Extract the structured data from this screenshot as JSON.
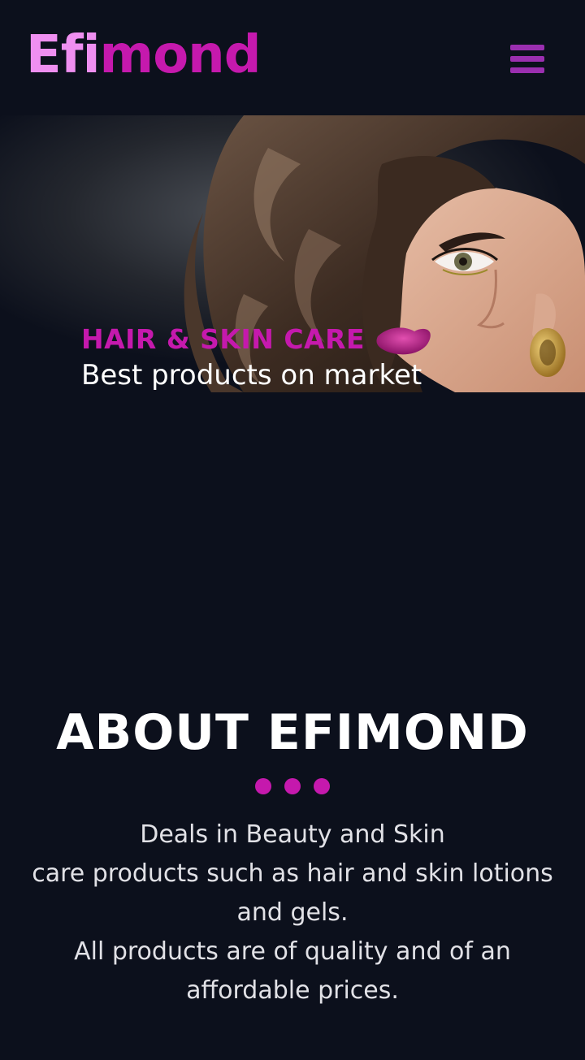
{
  "header": {
    "logo_part1": "Efi",
    "logo_part2": "mond",
    "menu_icon": "hamburger-menu-icon"
  },
  "hero": {
    "kicker": "HAIR & SKIN CARE",
    "subtitle": "Best products on market",
    "image": "woman-with-curly-hair-and-pink-lips"
  },
  "about": {
    "heading": "ABOUT EFIMOND",
    "lines": [
      "Deals in Beauty and Skin",
      "care products such as hair and skin lotions",
      "and gels.",
      "All products are of quality and of an",
      "affordable prices."
    ]
  },
  "colors": {
    "background": "#0c101c",
    "brand_light": "#ef8ff0",
    "brand_magenta": "#c519ad",
    "menu_purple": "#9b2fb0",
    "body_text": "#e1e1e6"
  }
}
